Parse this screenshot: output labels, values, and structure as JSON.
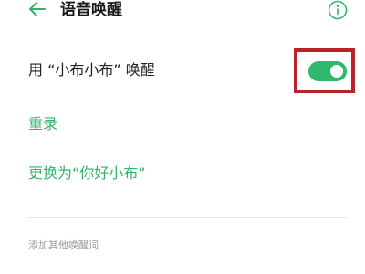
{
  "header": {
    "back_icon": "arrow-left-icon",
    "title": "语音唤醒",
    "info_icon": "info-circle-icon"
  },
  "wake_word_row": {
    "label": "用 “小布小布” 唤醒",
    "toggle_on": true,
    "toggle_color": "#2fb86e"
  },
  "actions": {
    "rerecord": "重录",
    "switch_to": "更换为“你好小布”"
  },
  "section": {
    "add_other": "添加其他唤醒词"
  },
  "colors": {
    "accent": "#35b26c",
    "highlight_box": "#b8242a"
  }
}
